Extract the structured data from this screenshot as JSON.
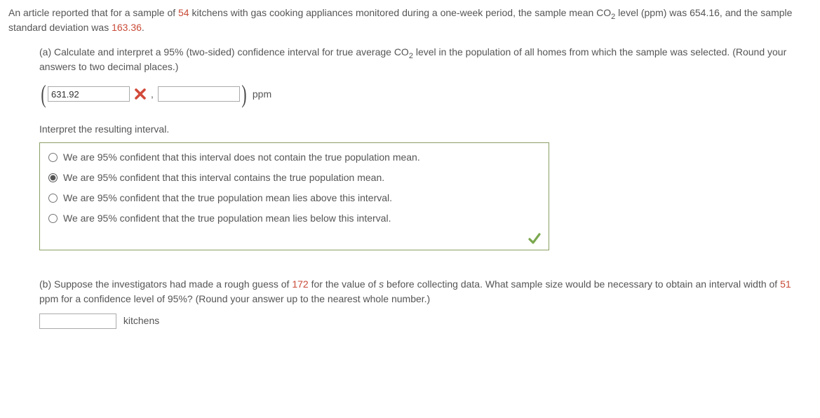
{
  "intro": {
    "seg1": "An article reported that for a sample of ",
    "n": "54",
    "seg2": " kitchens with gas cooking appliances monitored during a one-week period, the sample mean CO",
    "sub": "2",
    "seg3": " level (ppm) was 654.16, and the sample standard deviation was ",
    "sd": "163.36",
    "seg4": "."
  },
  "partA": {
    "seg1": "(a) Calculate and interpret a 95% (two-sided) confidence interval for true average CO",
    "sub": "2",
    "seg2": " level in the population of all homes from which the sample was selected. (Round your answers to two decimal places.)",
    "lower_value": "631.92",
    "upper_value": "",
    "unit": "ppm"
  },
  "interpret": {
    "heading": "Interpret the resulting interval.",
    "options": [
      "We are 95% confident that this interval does not contain the true population mean.",
      "We are 95% confident that this interval contains the true population mean.",
      "We are 95% confident that the true population mean lies above this interval.",
      "We are 95% confident that the true population mean lies below this interval."
    ],
    "selected_index": 1
  },
  "partB": {
    "seg1": "(b) Suppose the investigators had made a rough guess of ",
    "s_guess": "172",
    "seg2": " for the value of ",
    "seg3": " before collecting data. What sample size would be necessary to obtain an interval width of ",
    "width": "51",
    "seg4": " ppm for a confidence level of 95%? (Round your answer up to the nearest whole number.)",
    "answer_value": "",
    "unit": "kitchens"
  }
}
